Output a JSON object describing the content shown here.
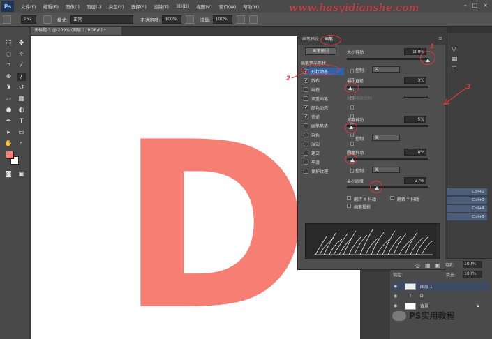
{
  "menubar": {
    "app_logo": "Ps",
    "items": [
      "文件(F)",
      "编辑(E)",
      "图像(I)",
      "图层(L)",
      "类型(Y)",
      "选择(S)",
      "滤镜(T)",
      "3D(D)",
      "视图(V)",
      "窗口(W)",
      "帮助(H)"
    ],
    "watermark": "www.hasyidianshe.com"
  },
  "options": {
    "size": "152",
    "mode_label": "模式:",
    "mode_value": "正常",
    "opacity_label": "不透明度:",
    "opacity_value": "100%",
    "flow_label": "流量:",
    "flow_value": "100%"
  },
  "document": {
    "tab_title": "未标题-1 @ 209% (图层 1, RGB/8) *",
    "canvas_letter": "D",
    "letter_color": "#f77e72"
  },
  "brush_panel": {
    "tab_brush": "画笔",
    "tab_presets": "画笔预设",
    "preset_button": "画笔预设",
    "tip_header": "画笔笔尖形状",
    "options": [
      {
        "label": "形状动态",
        "checked": true,
        "selected": true
      },
      {
        "label": "散布",
        "checked": true,
        "selected": false
      },
      {
        "label": "纹理",
        "checked": false,
        "selected": false
      },
      {
        "label": "双重画笔",
        "checked": false,
        "selected": false
      },
      {
        "label": "颜色动态",
        "checked": true,
        "selected": false
      },
      {
        "label": "传递",
        "checked": true,
        "selected": false
      },
      {
        "label": "画笔笔势",
        "checked": false,
        "selected": false
      },
      {
        "label": "杂色",
        "checked": false,
        "selected": false
      },
      {
        "label": "湿边",
        "checked": false,
        "selected": false
      },
      {
        "label": "建立",
        "checked": false,
        "selected": false
      },
      {
        "label": "平滑",
        "checked": false,
        "selected": false
      },
      {
        "label": "保护纹理",
        "checked": false,
        "selected": false
      }
    ],
    "size_jitter_label": "大小抖动",
    "size_jitter_value": "100%",
    "control_label": "控制:",
    "control_off": "关",
    "min_diameter_label": "最小直径",
    "min_diameter_value": "3%",
    "tilt_scale_label": "倾斜缩放比例",
    "angle_jitter_label": "角度抖动",
    "angle_jitter_value": "5%",
    "roundness_jitter_label": "圆度抖动",
    "roundness_jitter_value": "8%",
    "min_roundness_label": "最小圆度",
    "min_roundness_value": "37%",
    "flip_x_label": "翻转 X 抖动",
    "flip_y_label": "翻转 Y 抖动",
    "brush_projection_label": "画笔投影"
  },
  "shortcuts": [
    "Ctrl+2",
    "Ctrl+3",
    "Ctrl+4",
    "Ctrl+5"
  ],
  "layers": {
    "lock_label": "锁定:",
    "fill_label": "填充:",
    "fill_value": "100%",
    "opacity_label": "不透明度:",
    "opacity_value": "100%",
    "rows": [
      {
        "name": "图层 1",
        "kind": "pixel"
      },
      {
        "name": "D",
        "kind": "text"
      },
      {
        "name": "背景",
        "kind": "background"
      }
    ]
  },
  "annotations": [
    "1",
    "2",
    "3"
  ],
  "footer_watermark": "PS实用教程",
  "colors": {
    "foreground": "#f77e72",
    "background": "#ffffff",
    "annotation": "#e0393a"
  }
}
